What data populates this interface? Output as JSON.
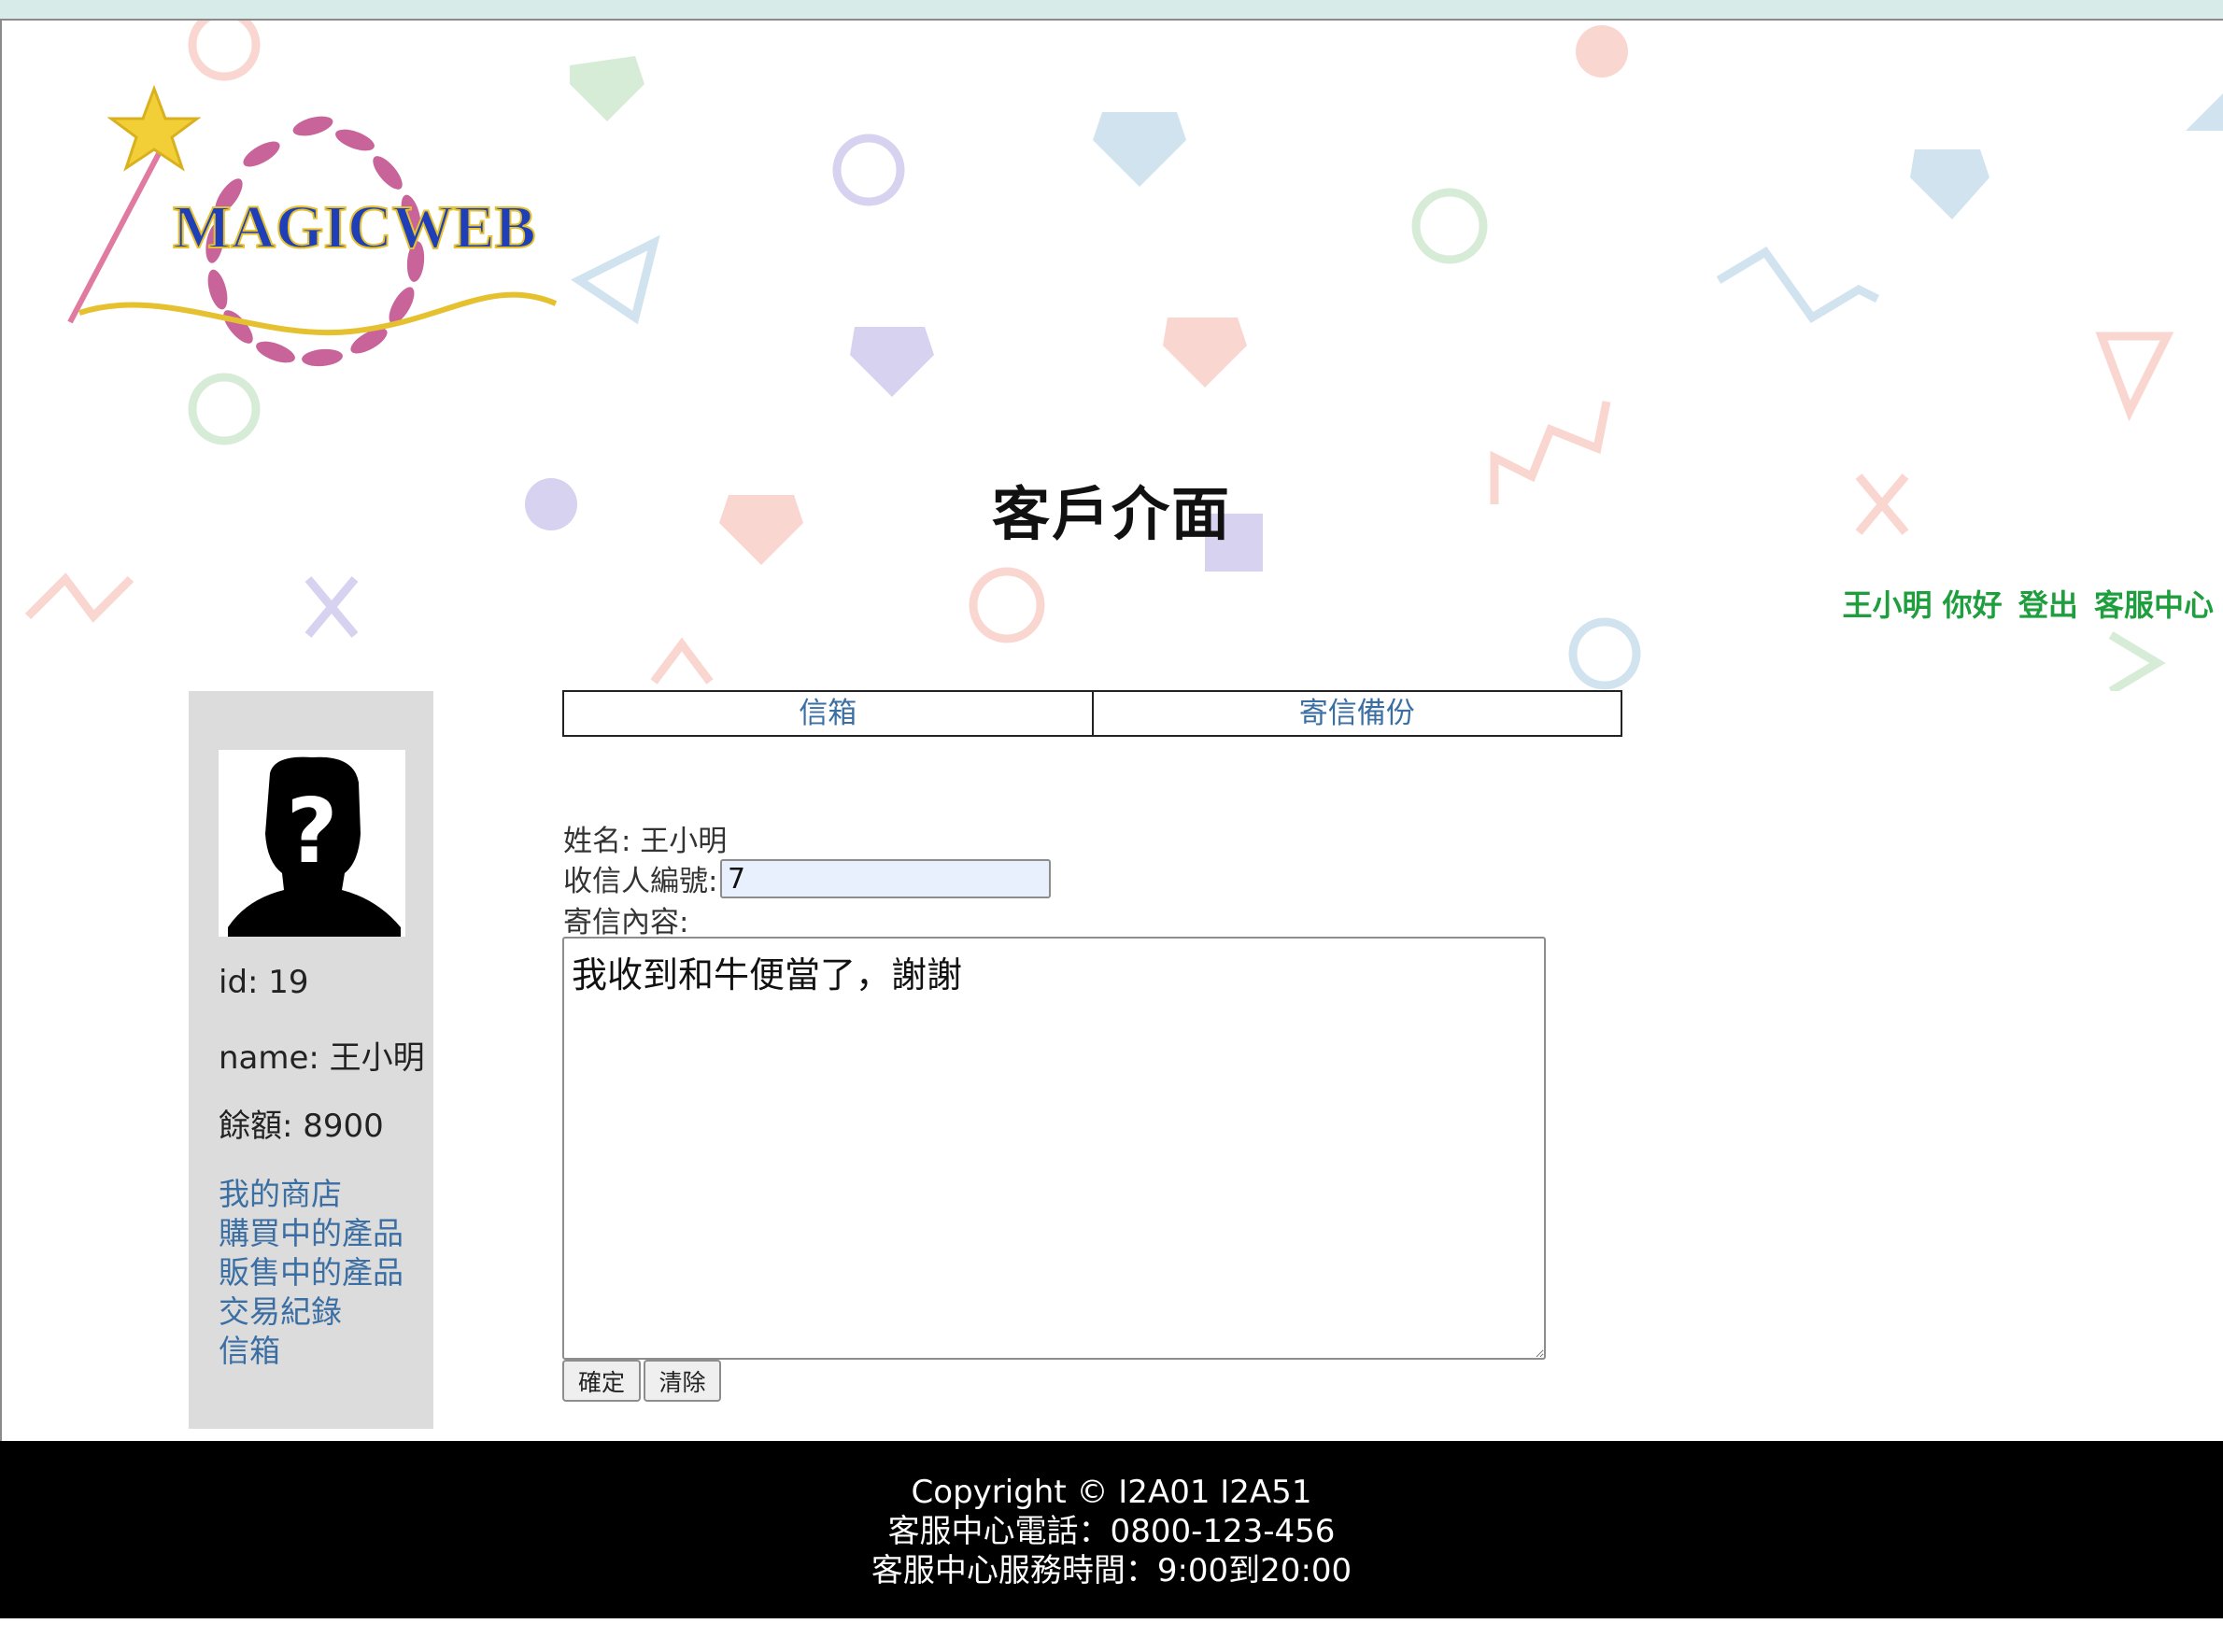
{
  "header": {
    "logo_text": "MAGICWEB",
    "page_title": "客戶介面",
    "greeting": "王小明 你好",
    "logout_label": "登出",
    "support_label": "客服中心"
  },
  "sidebar": {
    "avatar_icon": "unknown-user-silhouette",
    "id_text": "id: 19",
    "name_text": "name: 王小明",
    "balance_text": "餘額: 8900",
    "menu": [
      "我的商店",
      "購買中的產品",
      "販售中的產品",
      "交易紀錄",
      "信箱"
    ]
  },
  "tabs": [
    "信箱",
    "寄信備份"
  ],
  "form": {
    "name_label": "姓名: 王小明",
    "recipient_label": "收信人編號:",
    "recipient_value": "7",
    "content_label": "寄信內容:",
    "content_value": "我收到和牛便當了，謝謝",
    "submit_label": "確定",
    "clear_label": "清除"
  },
  "footer": {
    "copyright": "Copyright © I2A01 I2A51",
    "phone": "客服中心電話：0800-123-456",
    "hours": "客服中心服務時間：9:00到20:00"
  },
  "colors": {
    "link_blue": "#3b6fa3",
    "user_links_green": "#1f9e3e",
    "sidebar_bg": "#dcdcdc",
    "footer_bg": "#000000",
    "input_bg": "#e8f0fe"
  }
}
